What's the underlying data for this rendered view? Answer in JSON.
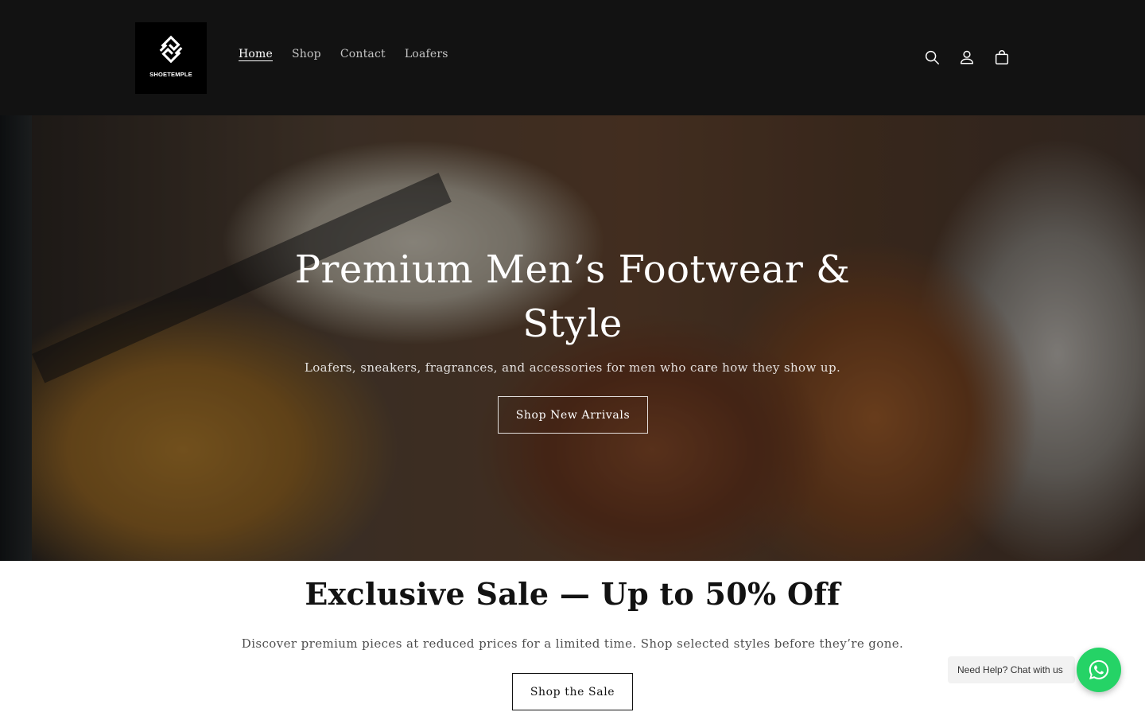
{
  "header": {
    "logo_text": "SHOETEMPLE",
    "nav": [
      {
        "label": "Home",
        "active": true
      },
      {
        "label": "Shop",
        "active": false
      },
      {
        "label": "Contact",
        "active": false
      },
      {
        "label": "Loafers",
        "active": false
      }
    ],
    "icons": [
      "search-icon",
      "account-icon",
      "cart-icon"
    ]
  },
  "hero": {
    "title": "Premium Men’s Footwear & Style",
    "subtitle": "Loafers, sneakers, fragrances, and accessories for men who care how they show up.",
    "button_label": "Shop New Arrivals"
  },
  "sale": {
    "title": "Exclusive Sale — Up to 50% Off",
    "subtitle": "Discover premium pieces at reduced prices for a limited time. Shop selected styles before they’re gone.",
    "button_label": "Shop the Sale"
  },
  "chat_widget": {
    "label": "Need Help? Chat with us",
    "icon": "whatsapp-icon",
    "color": "#25d366"
  },
  "colors": {
    "header_bg": "#121212",
    "text": "#121212"
  }
}
